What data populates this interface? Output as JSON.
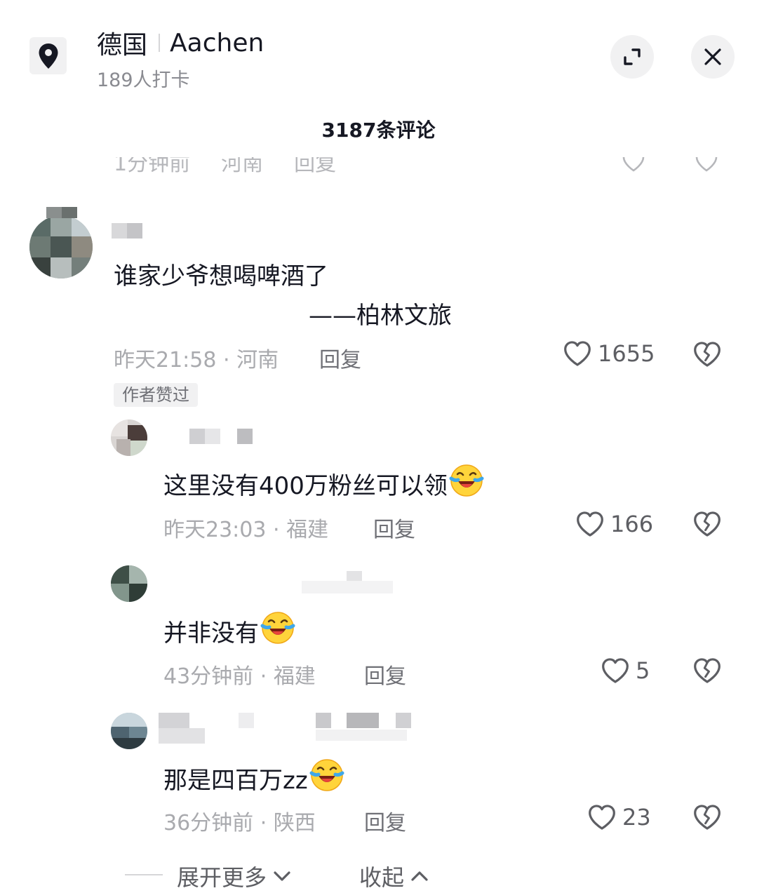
{
  "header": {
    "country": "德国",
    "city": "Aachen",
    "checkins": "189人打卡"
  },
  "comments_count": "3187条评论",
  "colors": {
    "text": "#161823",
    "muted": "#a9aaae",
    "button_bg": "#f1f1f2"
  },
  "comments": [
    {
      "text_line1": "谁家少爷想喝啤酒了",
      "text_line2": "——柏林文旅",
      "time": "昨天21:58",
      "location": "河南",
      "reply": "回复",
      "likes": "1655",
      "badge": "作者赞过"
    },
    {
      "text": "这里没有400万粉丝可以领",
      "emoji": "crying-laughing-emoji",
      "time": "昨天23:03",
      "location": "福建",
      "reply": "回复",
      "likes": "166"
    },
    {
      "text": "并非没有",
      "emoji": "crying-laughing-emoji",
      "time": "43分钟前",
      "location": "福建",
      "reply": "回复",
      "likes": "5"
    },
    {
      "text": "那是四百万zz",
      "emoji": "crying-laughing-emoji",
      "time": "36分钟前",
      "location": "陕西",
      "reply": "回复",
      "likes": "23"
    }
  ],
  "footer": {
    "expand": "展开更多",
    "collapse": "收起"
  },
  "icons": [
    "location-pin-icon",
    "expand-icon",
    "close-icon",
    "heart-icon",
    "broken-heart-icon",
    "chevron-down-icon",
    "chevron-up-icon"
  ]
}
